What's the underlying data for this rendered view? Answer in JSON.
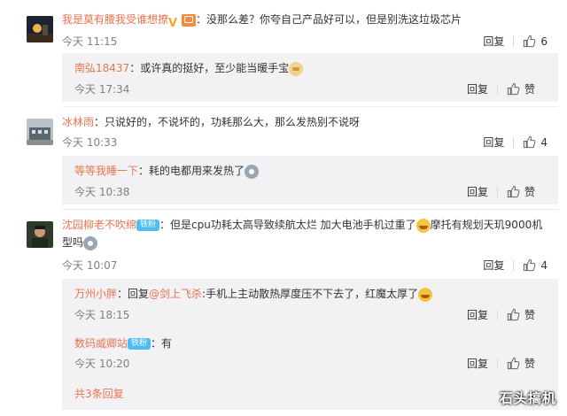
{
  "ui": {
    "reply_label": "回复",
    "like_zan_label": "赞"
  },
  "comments": [
    {
      "username": "我是莫有腰我受谁想撩",
      "text": "：没那么差？你夸自己产品好可以，但是别洗这垃圾芯片",
      "time": "今天 11:15",
      "likes": "6",
      "avatar_icon": "night-scene-avatar",
      "replies": [
        {
          "username": "南弘18437",
          "text": "：或许真的挺好，至少能当暖手宝",
          "emoji": "doge-emoji",
          "time": "今天 17:34"
        }
      ]
    },
    {
      "username": "冰林雨",
      "text": "：只说好的，不说坏的，功耗那么大，那么发热别不说呀",
      "time": "今天 10:33",
      "likes": "4",
      "avatar_icon": "building-avatar",
      "replies": [
        {
          "username": "等等我睡一下",
          "text": "：耗的电都用来发热了",
          "emoji": "cry-emoji",
          "time": "今天 10:38"
        }
      ]
    },
    {
      "username": "沈园柳老不吹绵",
      "badge": "铁粉",
      "text_part1": "：但是cpu功耗太高导致续航太烂 加大电池手机过重了",
      "text_part2": "摩托有规划天玑9000机型吗",
      "time": "今天 10:07",
      "likes": "4",
      "avatar_icon": "man-portrait-avatar",
      "replies": [
        {
          "username": "万州小胖",
          "reply_prefix": "：回复",
          "mention": "@剑上飞杀",
          "text": ":手机上主动散热厚度压不下去了，红魔太厚了",
          "emoji": "laugh-emoji",
          "time": "今天 18:15"
        },
        {
          "username": "数码威卿站",
          "badge": "铁粉",
          "text": "：有",
          "time": "今天 10:20"
        }
      ],
      "more_replies": "共3条回复"
    }
  ],
  "watermark": "石头搞机"
}
